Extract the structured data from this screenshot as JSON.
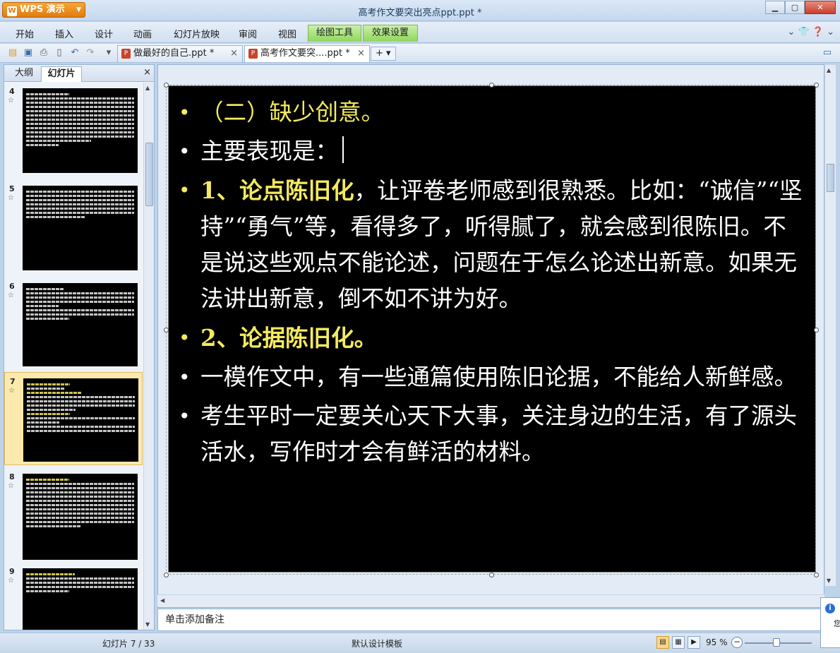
{
  "app": {
    "logo_label": "WPS 演示",
    "window_title": "高考作文要突出亮点ppt.ppt *"
  },
  "menu": {
    "items": [
      "开始",
      "插入",
      "设计",
      "动画",
      "幻灯片放映",
      "审阅",
      "视图"
    ],
    "context_tabs": [
      "绘图工具",
      "效果设置"
    ]
  },
  "doc_tabs": [
    {
      "label": "做最好的自己.ppt *"
    },
    {
      "label": "高考作文要突....ppt *"
    }
  ],
  "panel": {
    "tabs": [
      "大纲",
      "幻灯片"
    ],
    "close": "×"
  },
  "thumbnails": [
    {
      "num": "4",
      "selected": false
    },
    {
      "num": "5",
      "selected": false
    },
    {
      "num": "6",
      "selected": false
    },
    {
      "num": "7",
      "selected": true
    },
    {
      "num": "8",
      "selected": false
    },
    {
      "num": "9",
      "selected": false
    }
  ],
  "slide": {
    "b1": "（二）缺少创意。",
    "b2": "主要表现是：",
    "b3_head": "1、论点陈旧化",
    "b3_body": "，让评卷老师感到很熟悉。比如：“诚信”“坚持”“勇气”等，看得多了，听得腻了，就会感到很陈旧。不是说这些观点不能论述，问题在于怎么论述出新意。如果无法讲出新意，倒不如不讲为好。",
    "b4": "2、论据陈旧化。",
    "b5": "一模作文中，有一些通篇使用陈旧论据，不能给人新鲜感。",
    "b6": "考生平时一定要关心天下大事，关注身边的生活，有了源头活水，写作时才会有鲜活的材料。"
  },
  "notes": {
    "placeholder": "单击添加备注"
  },
  "status": {
    "slide_counter": "幻灯片 7 / 33",
    "template": "默认设计模板",
    "zoom": "95 %"
  },
  "popup": {
    "text": "您"
  },
  "colors": {
    "accent_yellow": "#f5ea5f",
    "slide_bg": "#000000",
    "wps_orange": "#e07b10"
  }
}
